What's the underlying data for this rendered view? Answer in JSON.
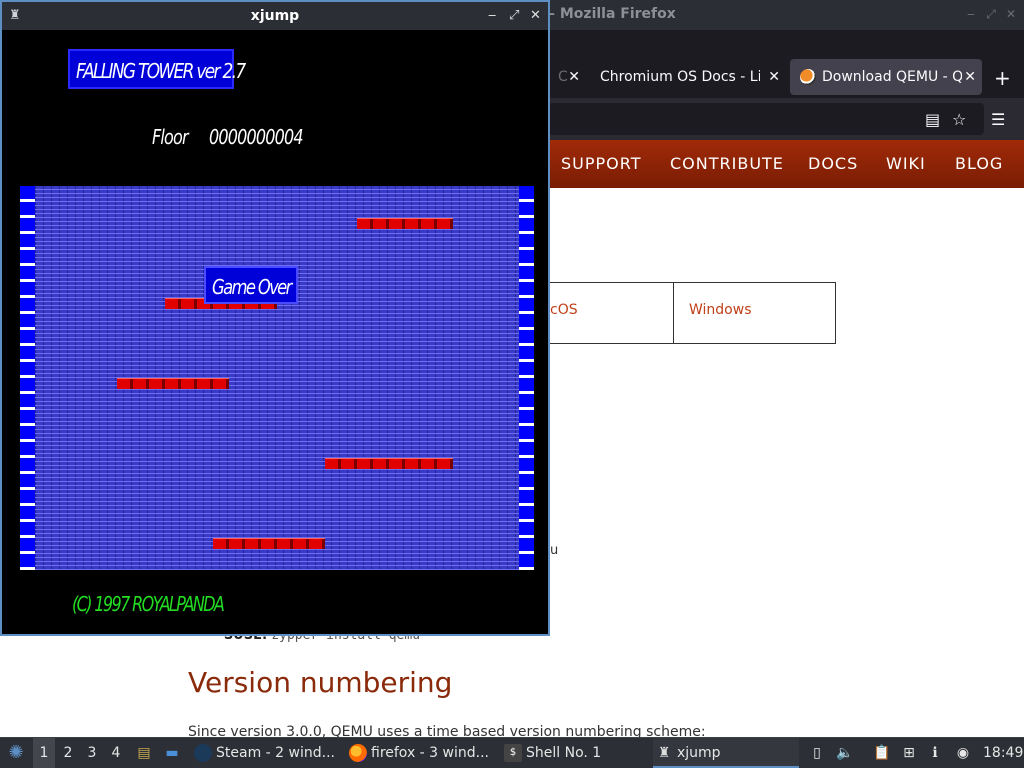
{
  "firefox": {
    "title": "– Mozilla Firefox",
    "tabs": [
      {
        "label": "C",
        "close": "✕"
      },
      {
        "label": "Chromium OS Docs - Lin",
        "close": "✕"
      },
      {
        "label": "Download QEMU - QE",
        "close": "✕"
      }
    ],
    "new_tab": "+",
    "nav": [
      "SUPPORT",
      "CONTRIBUTE",
      "DOCS",
      "WIKI",
      "BLOG"
    ],
    "os_tabs": [
      "cOS",
      "Windows"
    ],
    "partial_u": "u",
    "suse_label": "SUSE:",
    "suse_cmd": "zypper install qemu",
    "heading": "Version numbering",
    "paragraph": "Since version 3.0.0, QEMU uses a time based version numbering scheme:"
  },
  "xjump": {
    "title": "xjump",
    "logo": "FALLING TOWER ver 2.7",
    "floor_label": "Floor",
    "floor_value": "0000000004",
    "game_over": "Game Over",
    "copyright": "(C) 1997 ROYALPANDA",
    "buttons": {
      "minimize": "‒",
      "maximize": "⤢",
      "close": "✕"
    },
    "platforms": [
      {
        "start": 337,
        "count": 6
      },
      {
        "start": 145,
        "count": 7
      },
      {
        "start": 97,
        "count": 7
      },
      {
        "start": 305,
        "count": 8
      },
      {
        "start": 193,
        "count": 7
      }
    ]
  },
  "taskbar": {
    "workspaces": [
      "1",
      "2",
      "3",
      "4"
    ],
    "active_workspace": "1",
    "tasks": [
      {
        "label": "Steam - 2 wind...",
        "icon": "steam-icon"
      },
      {
        "label": "firefox - 3 wind...",
        "icon": "firefox-icon"
      },
      {
        "label": "Shell No. 1",
        "icon": "terminal-icon"
      },
      {
        "label": "xjump",
        "icon": "xjump-icon"
      }
    ],
    "clock": "18:49",
    "colors": {
      "accent": "#5d8fc4",
      "bar": "#2c2f35"
    }
  }
}
